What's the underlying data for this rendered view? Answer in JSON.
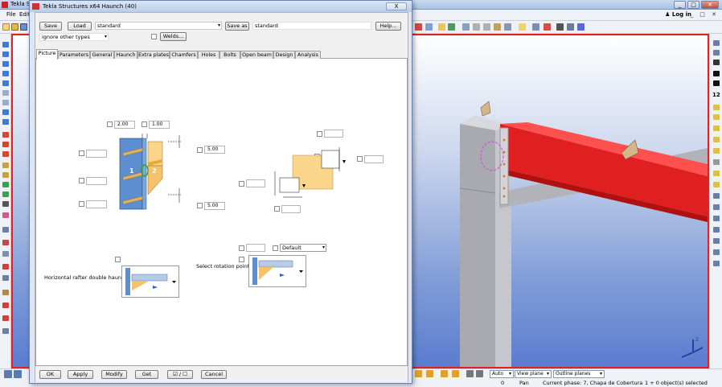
{
  "app": {
    "title": "Tekla Str...",
    "menu": [
      "File",
      "Edit"
    ],
    "login_label": "Log in"
  },
  "dialog": {
    "title": "Tekla Structures x64  Haunch (40)",
    "close_label": "X",
    "save_label": "Save",
    "load_label": "Load",
    "load_value": "standard",
    "save_as_label": "Save as",
    "save_as_value": "standard",
    "help_label": "Help...",
    "filter_value": "ignore other types",
    "welds_label": "Welds...",
    "tabs": [
      "Picture",
      "Parameters",
      "General",
      "Haunch",
      "Extra plates",
      "Chamfers",
      "Holes",
      "Bolts",
      "Open beam",
      "Design",
      "Analysis"
    ],
    "active_tab": "Picture",
    "picture": {
      "dim_top_left": "2.00",
      "dim_top_right": "1.00",
      "dim_right_upper": "5.00",
      "dim_right_lower": "5.00",
      "part_label_1": "1",
      "part_label_2": "2",
      "rafter_label": "Horizontal rafter double haunch",
      "rotation_label": "Select rotation point:",
      "rotation_combo": "Default"
    },
    "buttons": {
      "ok": "OK",
      "apply": "Apply",
      "modify": "Modify",
      "get": "Get",
      "toggle": "☑ / ☐",
      "cancel": "Cancel"
    }
  },
  "statusbar": {
    "view_auto": "Auto",
    "view_plane": "View plane",
    "outline_planes": "Outline planes",
    "zero": "0",
    "pan": "Pan",
    "phase": "Current phase: 7, Chapa de Cobertura",
    "selected": "1 + 0 object(s) selected"
  },
  "colors": {
    "viewport_border": "#e52020",
    "beam_red": "#e02020",
    "column_grey": "#b9b9b9",
    "plate_yellow": "#f5c26b",
    "steel_blue": "#5d8fd0"
  }
}
